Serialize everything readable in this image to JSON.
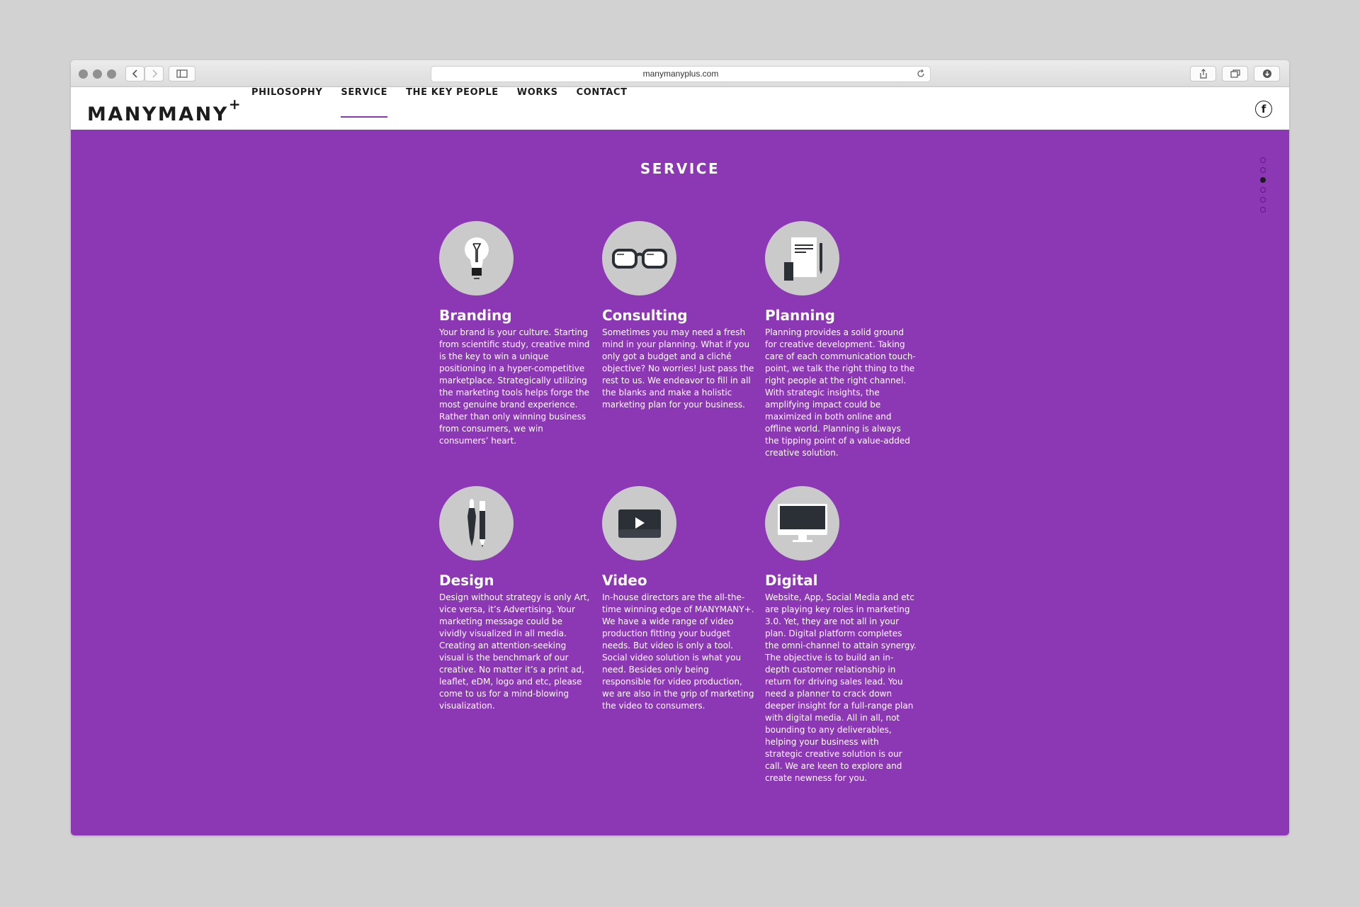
{
  "browser": {
    "url": "manymanyplus.com",
    "icons": [
      "close-light",
      "minimize-light",
      "zoom-light",
      "back-icon",
      "forward-icon",
      "sidebar-icon",
      "reload-icon",
      "share-icon",
      "tabs-icon",
      "download-icon"
    ]
  },
  "header": {
    "logo": "MANYMANY",
    "logo_sup": "+",
    "nav": [
      {
        "label": "PHILOSOPHY",
        "active": false
      },
      {
        "label": "SERVICE",
        "active": true
      },
      {
        "label": "THE KEY PEOPLE",
        "active": false
      },
      {
        "label": "WORKS",
        "active": false
      },
      {
        "label": "CONTACT",
        "active": false
      }
    ],
    "facebook_glyph": "f"
  },
  "section": {
    "title": "SERVICE",
    "pager": {
      "count": 6,
      "active_index": 2
    },
    "accent_color": "#8c38b4",
    "services": [
      {
        "title": "Branding",
        "icon": "lightbulb-icon",
        "text": "Your brand is your culture. Starting from scientific study, creative mind is the key to win a unique positioning in a hyper-competitive marketplace. Strategically utilizing the marketing tools helps forge the most genuine brand experience. Rather than only winning business from consumers, we win consumers’ heart."
      },
      {
        "title": "Consulting",
        "icon": "glasses-icon",
        "text": "Sometimes you may need a fresh mind in your planning. What if you only got a budget and a cliché objective? No worries! Just pass the rest to us. We endeavor to fill in all the blanks and make a holistic marketing plan for your business."
      },
      {
        "title": "Planning",
        "icon": "document-pen-icon",
        "text": "Planning provides a solid ground for creative development. Taking care of each communication touch-point, we talk the right thing to the right people at the right channel. With strategic insights, the amplifying impact could be maximized in both online and offline world. Planning is always the tipping point of a value-added creative solution."
      },
      {
        "title": "Design",
        "icon": "brush-pen-icon",
        "text": "Design without strategy is only Art, vice versa, it’s Advertising. Your marketing message could be vividly visualized in all media. Creating an attention-seeking visual is the benchmark of our creative. No matter it’s a print ad, leaflet, eDM, logo and etc, please come to us for a mind-blowing visualization."
      },
      {
        "title": "Video",
        "icon": "video-play-icon",
        "text": "In-house directors are the all-the-time winning edge of MANYMANY+. We have a wide range of video production fitting your budget needs. But video is only a tool. Social video solution is what you need. Besides only being responsible for video production, we are also in the grip of marketing the video to consumers."
      },
      {
        "title": "Digital",
        "icon": "monitor-icon",
        "text": "Website, App, Social Media and etc are playing key roles in marketing 3.0. Yet, they are not all in your plan. Digital platform completes the omni-channel to attain synergy. The objective is to build an in-depth customer relationship in return for driving sales lead. You need a planner to crack down deeper insight for a full-range plan with digital media. All in all, not bounding to any deliverables, helping your business with strategic creative solution is our call. We are keen to explore and create newness for you."
      }
    ]
  }
}
